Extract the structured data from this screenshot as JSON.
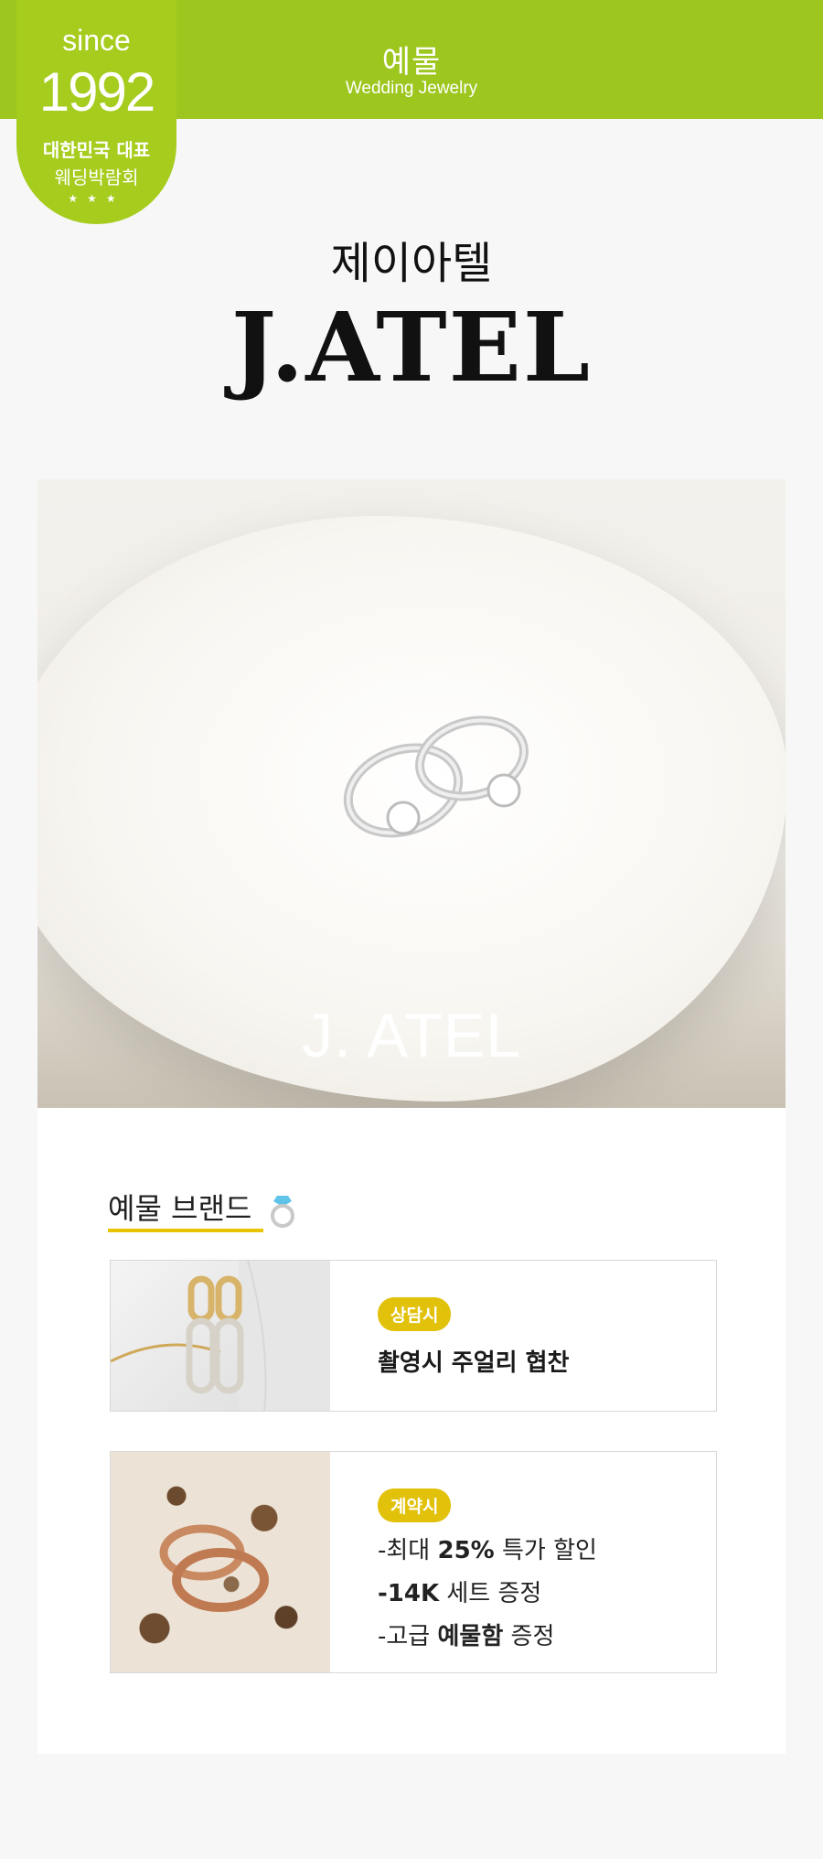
{
  "header": {
    "title": "예물",
    "subtitle": "Wedding Jewelry"
  },
  "badge": {
    "since": "since",
    "year": "1992",
    "line1": "대한민국 대표",
    "line2": "웨딩박람회",
    "stars": "★★★"
  },
  "brand": {
    "name_kr": "제이아텔",
    "name_en": "J.ATEL"
  },
  "hero": {
    "watermark": "J. ATEL"
  },
  "section": {
    "title": "예물 브랜드"
  },
  "cards": [
    {
      "tag": "상담시",
      "desc": "촬영시 주얼리 협찬"
    },
    {
      "tag": "계약시",
      "bullets": [
        {
          "pre": "-최대 ",
          "bold": "25%",
          "post": " 특가 할인"
        },
        {
          "pre": "",
          "bold": "-14K",
          "post": " 세트 증정"
        },
        {
          "pre": "-고급 ",
          "bold": "예물함",
          "post": " 증정"
        }
      ]
    }
  ],
  "colors": {
    "header_green": "#9dc61e",
    "badge_green": "#a6cc1e",
    "accent_yellow": "#e2c10a",
    "underline_yellow": "#e8c400"
  }
}
